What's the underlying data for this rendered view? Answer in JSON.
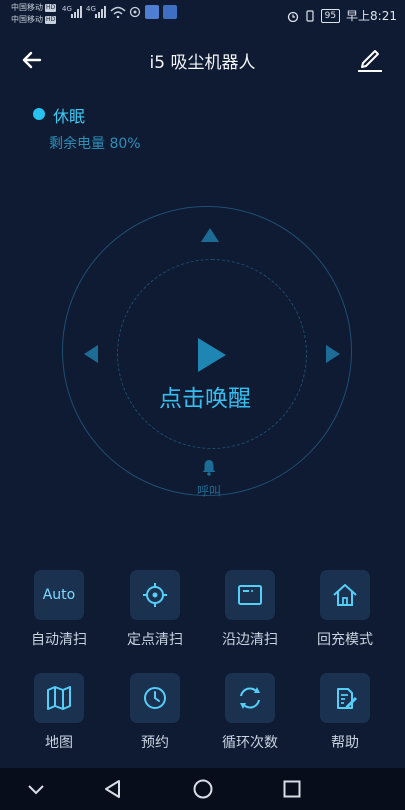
{
  "statusbar": {
    "carrier1": "中国移动",
    "carrier2": "中国移动",
    "hd": "HD",
    "net1": "4G",
    "net2": "4G",
    "battery": "95",
    "time": "早上8:21"
  },
  "header": {
    "title": "i5 吸尘机器人"
  },
  "robot": {
    "state": "休眠",
    "battery_text": "剩余电量 80%"
  },
  "control": {
    "wake_label": "点击唤醒",
    "call_label": "呼叫"
  },
  "functions": [
    {
      "label": "自动清扫",
      "tile_text": "Auto",
      "icon": "auto-text"
    },
    {
      "label": "定点清扫",
      "icon": "crosshair-icon"
    },
    {
      "label": "沿边清扫",
      "icon": "edge-icon"
    },
    {
      "label": "回充模式",
      "icon": "home-icon"
    },
    {
      "label": "地图",
      "icon": "map-icon"
    },
    {
      "label": "预约",
      "icon": "clock-icon"
    },
    {
      "label": "循环次数",
      "icon": "cycle-icon"
    },
    {
      "label": "帮助",
      "icon": "help-icon"
    }
  ],
  "colors": {
    "background": "#0f1a33",
    "accent": "#35bff0",
    "tile": "#1a3150"
  }
}
